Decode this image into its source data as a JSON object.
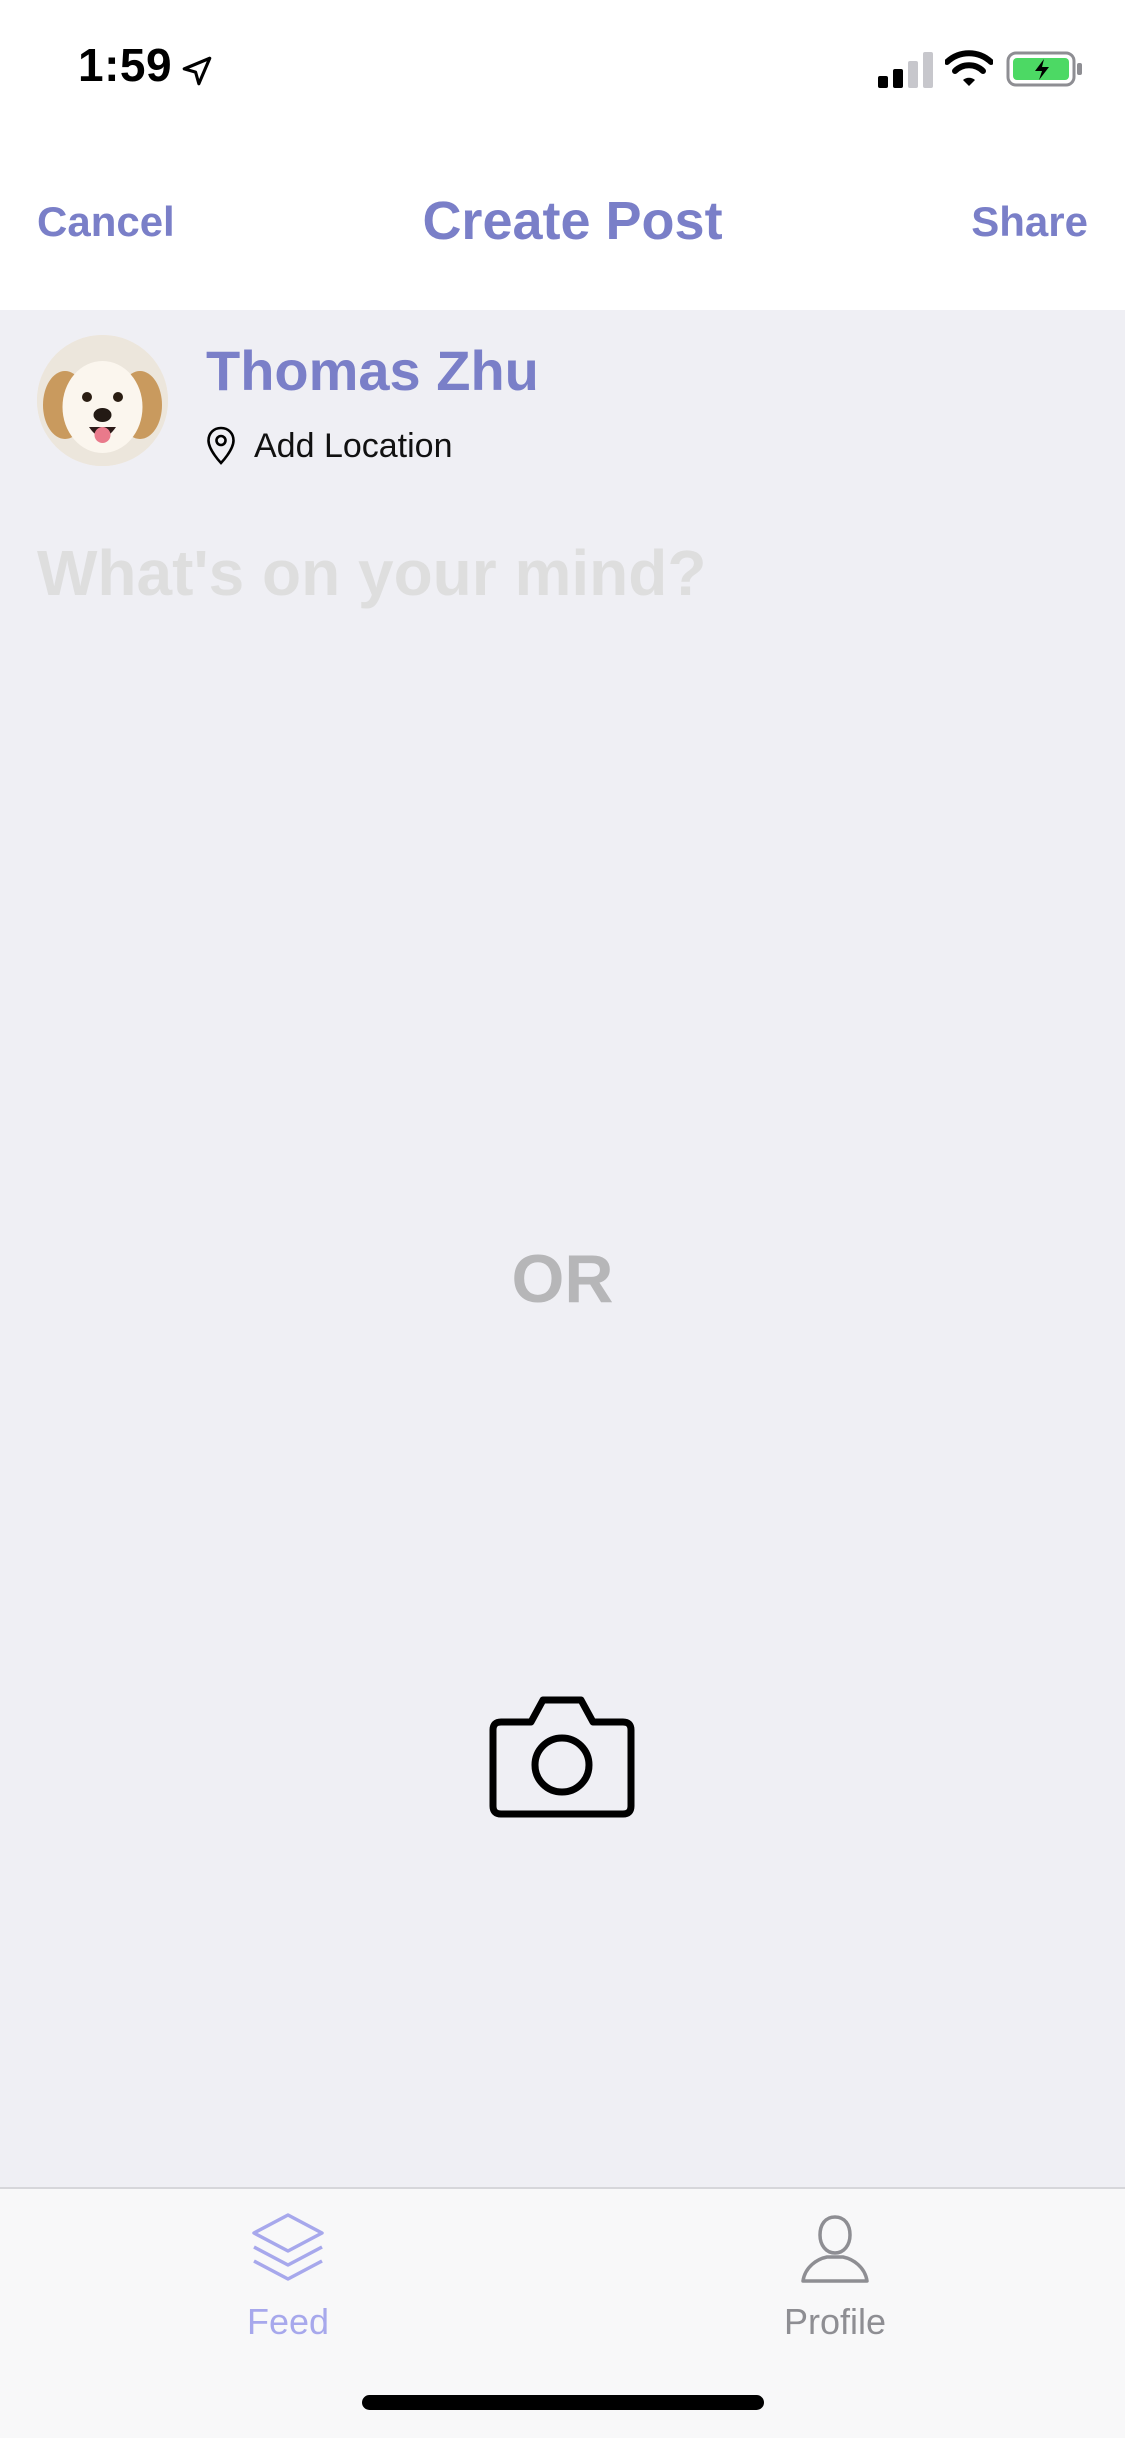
{
  "status_bar": {
    "time": "1:59",
    "icons": [
      "location-arrow-icon",
      "cellular-signal-icon",
      "wifi-icon",
      "battery-charging-icon"
    ]
  },
  "nav": {
    "cancel_label": "Cancel",
    "title": "Create Post",
    "share_label": "Share"
  },
  "user": {
    "name": "Thomas Zhu",
    "avatar_icon": "dog-avatar",
    "location_icon": "map-pin-icon",
    "location_label": "Add Location"
  },
  "composer": {
    "value": "",
    "placeholder": "What's on your mind?",
    "or_label": "OR",
    "camera_icon": "camera-icon"
  },
  "tab_bar": {
    "tabs": [
      {
        "label": "Feed",
        "icon": "layers-icon",
        "active": true
      },
      {
        "label": "Profile",
        "icon": "person-icon",
        "active": false
      }
    ]
  },
  "colors": {
    "accent": "#7a7fc8",
    "tab_active": "#a7a8ec",
    "tab_inactive": "#8e8e93",
    "background": "#efeff4",
    "placeholder": "#dedede",
    "or_text": "#b6b6b8"
  }
}
